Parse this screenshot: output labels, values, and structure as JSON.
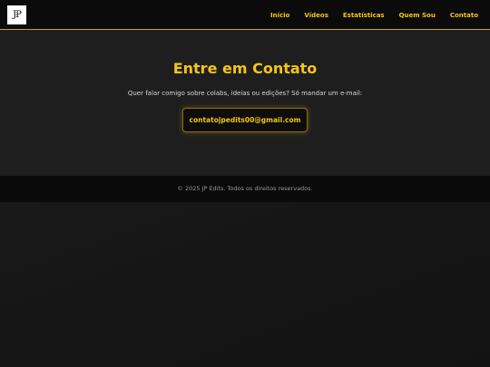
{
  "header": {
    "logo_text": "JP",
    "nav": [
      {
        "label": "Início"
      },
      {
        "label": "Vídeos"
      },
      {
        "label": "Estatísticas"
      },
      {
        "label": "Quem Sou"
      },
      {
        "label": "Contato"
      }
    ]
  },
  "contact": {
    "title": "Entre em Contato",
    "text": "Quer falar comigo sobre colabs, ideias ou edições? Só mandar um e-mail:",
    "email": "contatojpedits00@gmail.com"
  },
  "footer": {
    "text": "© 2025 JP Edits. Todos os direitos reservados."
  },
  "colors": {
    "accent": "#f5c518",
    "header_bg": "#0b0b0b",
    "section_bg": "#1e1e1e",
    "footer_bg": "#0a0a0a"
  }
}
